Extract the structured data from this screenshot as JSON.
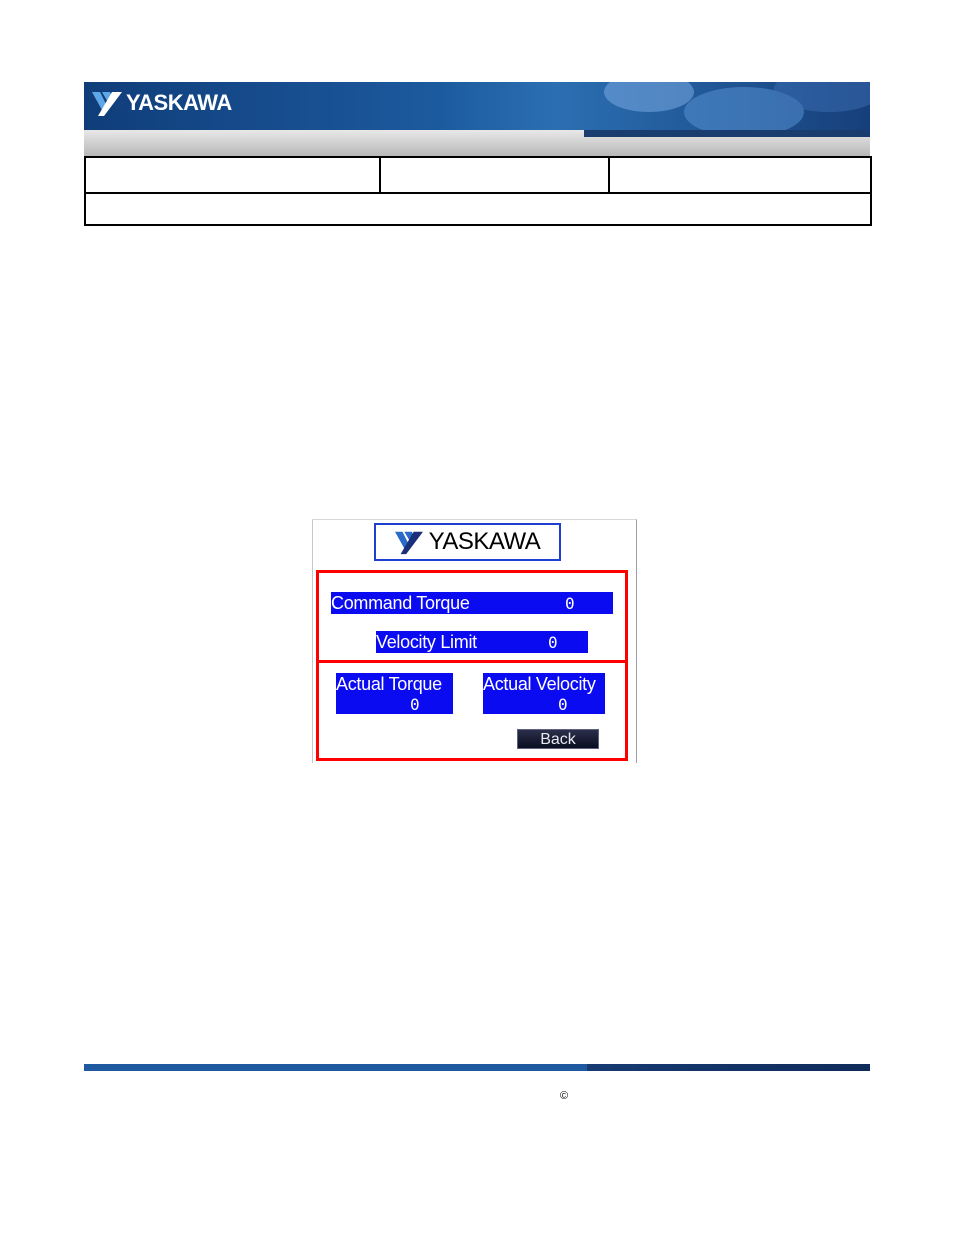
{
  "header": {
    "brand": "YASKAWA",
    "logo_icon": "yaskawa-wing-logo"
  },
  "hmi": {
    "brand": "YASKAWA",
    "command_torque": {
      "label": "Command Torque",
      "value": "0"
    },
    "velocity_limit": {
      "label": "Velocity Limit",
      "value": "0"
    },
    "actual_torque": {
      "label": "Actual Torque",
      "value": "0"
    },
    "actual_velocity": {
      "label": "Actual Velocity",
      "value": "0"
    },
    "back_label": "Back",
    "colors": {
      "field_bg": "#0b0bf2",
      "highlight_border": "#ff0000",
      "logo_border": "#1e3fd0"
    }
  },
  "footer": {
    "copyright": "©"
  }
}
